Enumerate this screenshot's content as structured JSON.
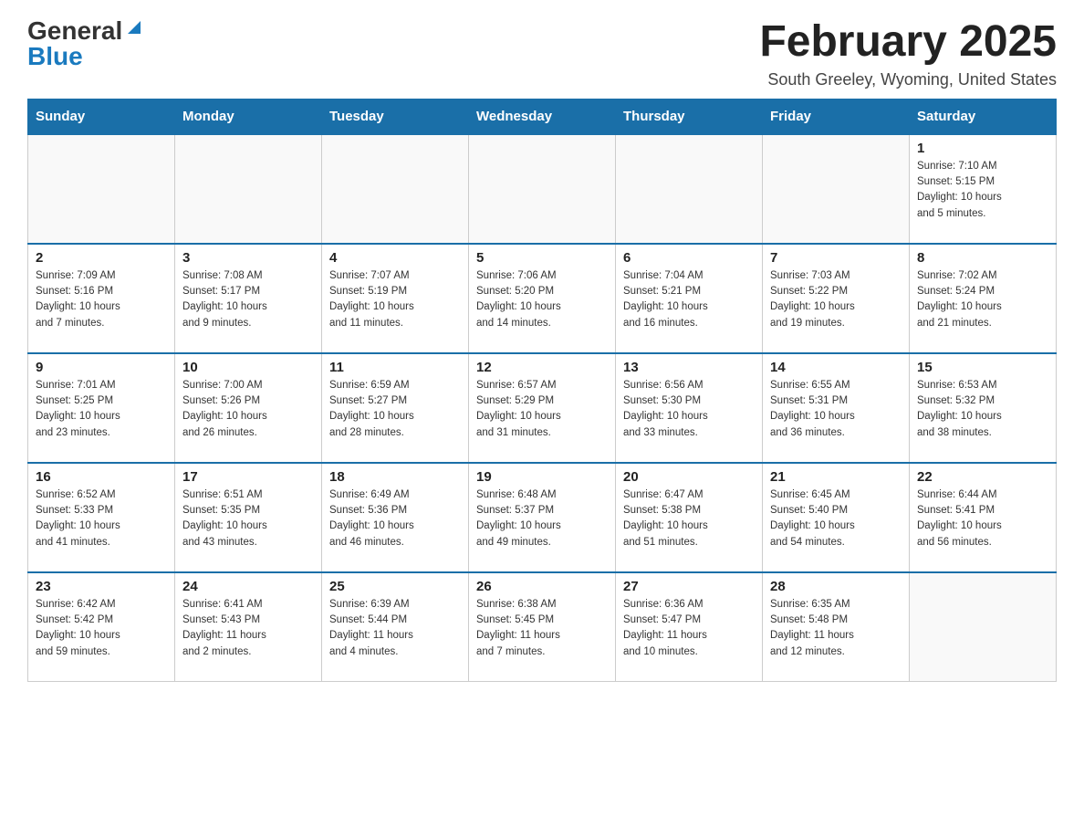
{
  "header": {
    "logo_general": "General",
    "logo_blue": "Blue",
    "month_title": "February 2025",
    "location": "South Greeley, Wyoming, United States"
  },
  "weekdays": [
    "Sunday",
    "Monday",
    "Tuesday",
    "Wednesday",
    "Thursday",
    "Friday",
    "Saturday"
  ],
  "weeks": [
    [
      {
        "day": "",
        "info": ""
      },
      {
        "day": "",
        "info": ""
      },
      {
        "day": "",
        "info": ""
      },
      {
        "day": "",
        "info": ""
      },
      {
        "day": "",
        "info": ""
      },
      {
        "day": "",
        "info": ""
      },
      {
        "day": "1",
        "info": "Sunrise: 7:10 AM\nSunset: 5:15 PM\nDaylight: 10 hours\nand 5 minutes."
      }
    ],
    [
      {
        "day": "2",
        "info": "Sunrise: 7:09 AM\nSunset: 5:16 PM\nDaylight: 10 hours\nand 7 minutes."
      },
      {
        "day": "3",
        "info": "Sunrise: 7:08 AM\nSunset: 5:17 PM\nDaylight: 10 hours\nand 9 minutes."
      },
      {
        "day": "4",
        "info": "Sunrise: 7:07 AM\nSunset: 5:19 PM\nDaylight: 10 hours\nand 11 minutes."
      },
      {
        "day": "5",
        "info": "Sunrise: 7:06 AM\nSunset: 5:20 PM\nDaylight: 10 hours\nand 14 minutes."
      },
      {
        "day": "6",
        "info": "Sunrise: 7:04 AM\nSunset: 5:21 PM\nDaylight: 10 hours\nand 16 minutes."
      },
      {
        "day": "7",
        "info": "Sunrise: 7:03 AM\nSunset: 5:22 PM\nDaylight: 10 hours\nand 19 minutes."
      },
      {
        "day": "8",
        "info": "Sunrise: 7:02 AM\nSunset: 5:24 PM\nDaylight: 10 hours\nand 21 minutes."
      }
    ],
    [
      {
        "day": "9",
        "info": "Sunrise: 7:01 AM\nSunset: 5:25 PM\nDaylight: 10 hours\nand 23 minutes."
      },
      {
        "day": "10",
        "info": "Sunrise: 7:00 AM\nSunset: 5:26 PM\nDaylight: 10 hours\nand 26 minutes."
      },
      {
        "day": "11",
        "info": "Sunrise: 6:59 AM\nSunset: 5:27 PM\nDaylight: 10 hours\nand 28 minutes."
      },
      {
        "day": "12",
        "info": "Sunrise: 6:57 AM\nSunset: 5:29 PM\nDaylight: 10 hours\nand 31 minutes."
      },
      {
        "day": "13",
        "info": "Sunrise: 6:56 AM\nSunset: 5:30 PM\nDaylight: 10 hours\nand 33 minutes."
      },
      {
        "day": "14",
        "info": "Sunrise: 6:55 AM\nSunset: 5:31 PM\nDaylight: 10 hours\nand 36 minutes."
      },
      {
        "day": "15",
        "info": "Sunrise: 6:53 AM\nSunset: 5:32 PM\nDaylight: 10 hours\nand 38 minutes."
      }
    ],
    [
      {
        "day": "16",
        "info": "Sunrise: 6:52 AM\nSunset: 5:33 PM\nDaylight: 10 hours\nand 41 minutes."
      },
      {
        "day": "17",
        "info": "Sunrise: 6:51 AM\nSunset: 5:35 PM\nDaylight: 10 hours\nand 43 minutes."
      },
      {
        "day": "18",
        "info": "Sunrise: 6:49 AM\nSunset: 5:36 PM\nDaylight: 10 hours\nand 46 minutes."
      },
      {
        "day": "19",
        "info": "Sunrise: 6:48 AM\nSunset: 5:37 PM\nDaylight: 10 hours\nand 49 minutes."
      },
      {
        "day": "20",
        "info": "Sunrise: 6:47 AM\nSunset: 5:38 PM\nDaylight: 10 hours\nand 51 minutes."
      },
      {
        "day": "21",
        "info": "Sunrise: 6:45 AM\nSunset: 5:40 PM\nDaylight: 10 hours\nand 54 minutes."
      },
      {
        "day": "22",
        "info": "Sunrise: 6:44 AM\nSunset: 5:41 PM\nDaylight: 10 hours\nand 56 minutes."
      }
    ],
    [
      {
        "day": "23",
        "info": "Sunrise: 6:42 AM\nSunset: 5:42 PM\nDaylight: 10 hours\nand 59 minutes."
      },
      {
        "day": "24",
        "info": "Sunrise: 6:41 AM\nSunset: 5:43 PM\nDaylight: 11 hours\nand 2 minutes."
      },
      {
        "day": "25",
        "info": "Sunrise: 6:39 AM\nSunset: 5:44 PM\nDaylight: 11 hours\nand 4 minutes."
      },
      {
        "day": "26",
        "info": "Sunrise: 6:38 AM\nSunset: 5:45 PM\nDaylight: 11 hours\nand 7 minutes."
      },
      {
        "day": "27",
        "info": "Sunrise: 6:36 AM\nSunset: 5:47 PM\nDaylight: 11 hours\nand 10 minutes."
      },
      {
        "day": "28",
        "info": "Sunrise: 6:35 AM\nSunset: 5:48 PM\nDaylight: 11 hours\nand 12 minutes."
      },
      {
        "day": "",
        "info": ""
      }
    ]
  ]
}
